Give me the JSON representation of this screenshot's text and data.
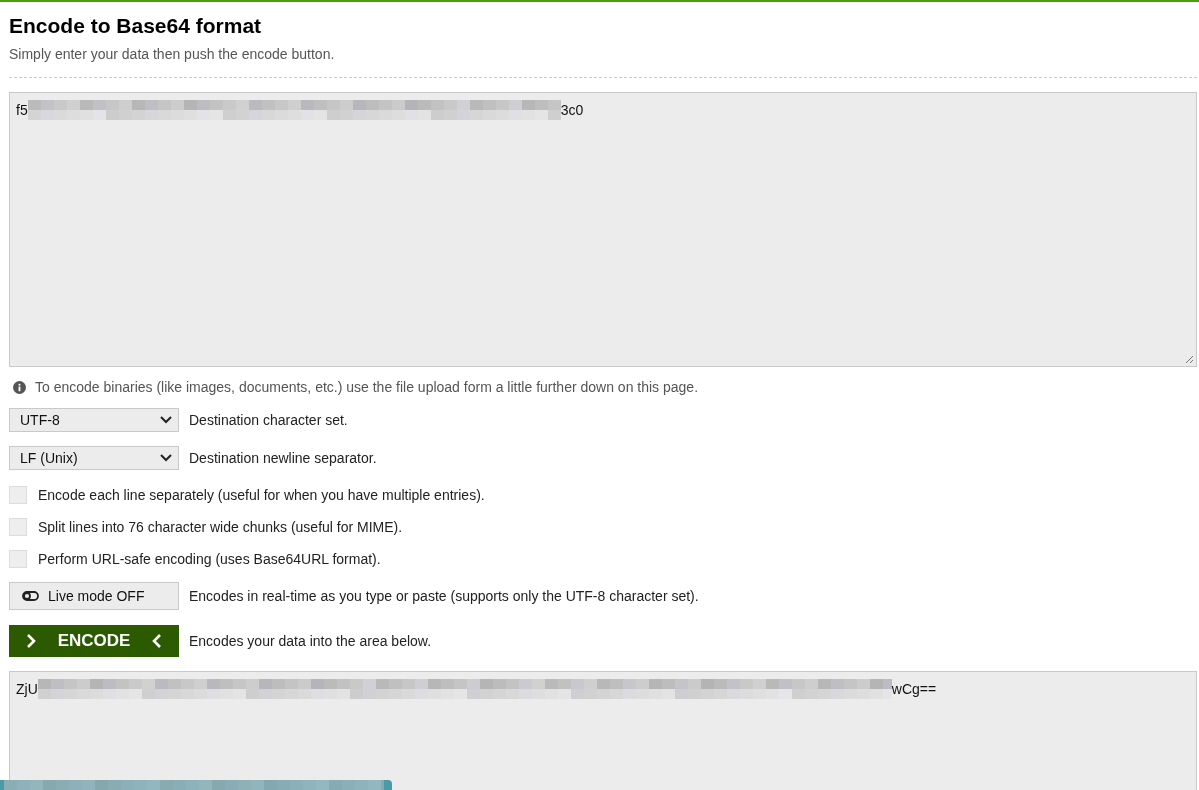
{
  "header": {
    "title": "Encode to Base64 format",
    "subtitle": "Simply enter your data then push the encode button."
  },
  "input": {
    "text_start": "f5",
    "text_end": "3c0",
    "redacted": true
  },
  "info": "To encode binaries (like images, documents, etc.) use the file upload form a little further down on this page.",
  "selects": [
    {
      "value": "UTF-8",
      "label": "Destination character set."
    },
    {
      "value": "LF (Unix)",
      "label": "Destination newline separator."
    }
  ],
  "checkboxes": [
    {
      "checked": false,
      "label": "Encode each line separately (useful for when you have multiple entries)."
    },
    {
      "checked": false,
      "label": "Split lines into 76 character wide chunks (useful for MIME)."
    },
    {
      "checked": false,
      "label": "Perform URL-safe encoding (uses Base64URL format)."
    }
  ],
  "live_mode": {
    "on": false,
    "text": "Live mode OFF",
    "label": "Encodes in real-time as you type or paste (supports only the UTF-8 character set)."
  },
  "encode": {
    "text": "ENCODE",
    "label": "Encodes your data into the area below."
  },
  "output": {
    "text_start": "ZjU",
    "text_end": "wCg==",
    "redacted": true
  }
}
